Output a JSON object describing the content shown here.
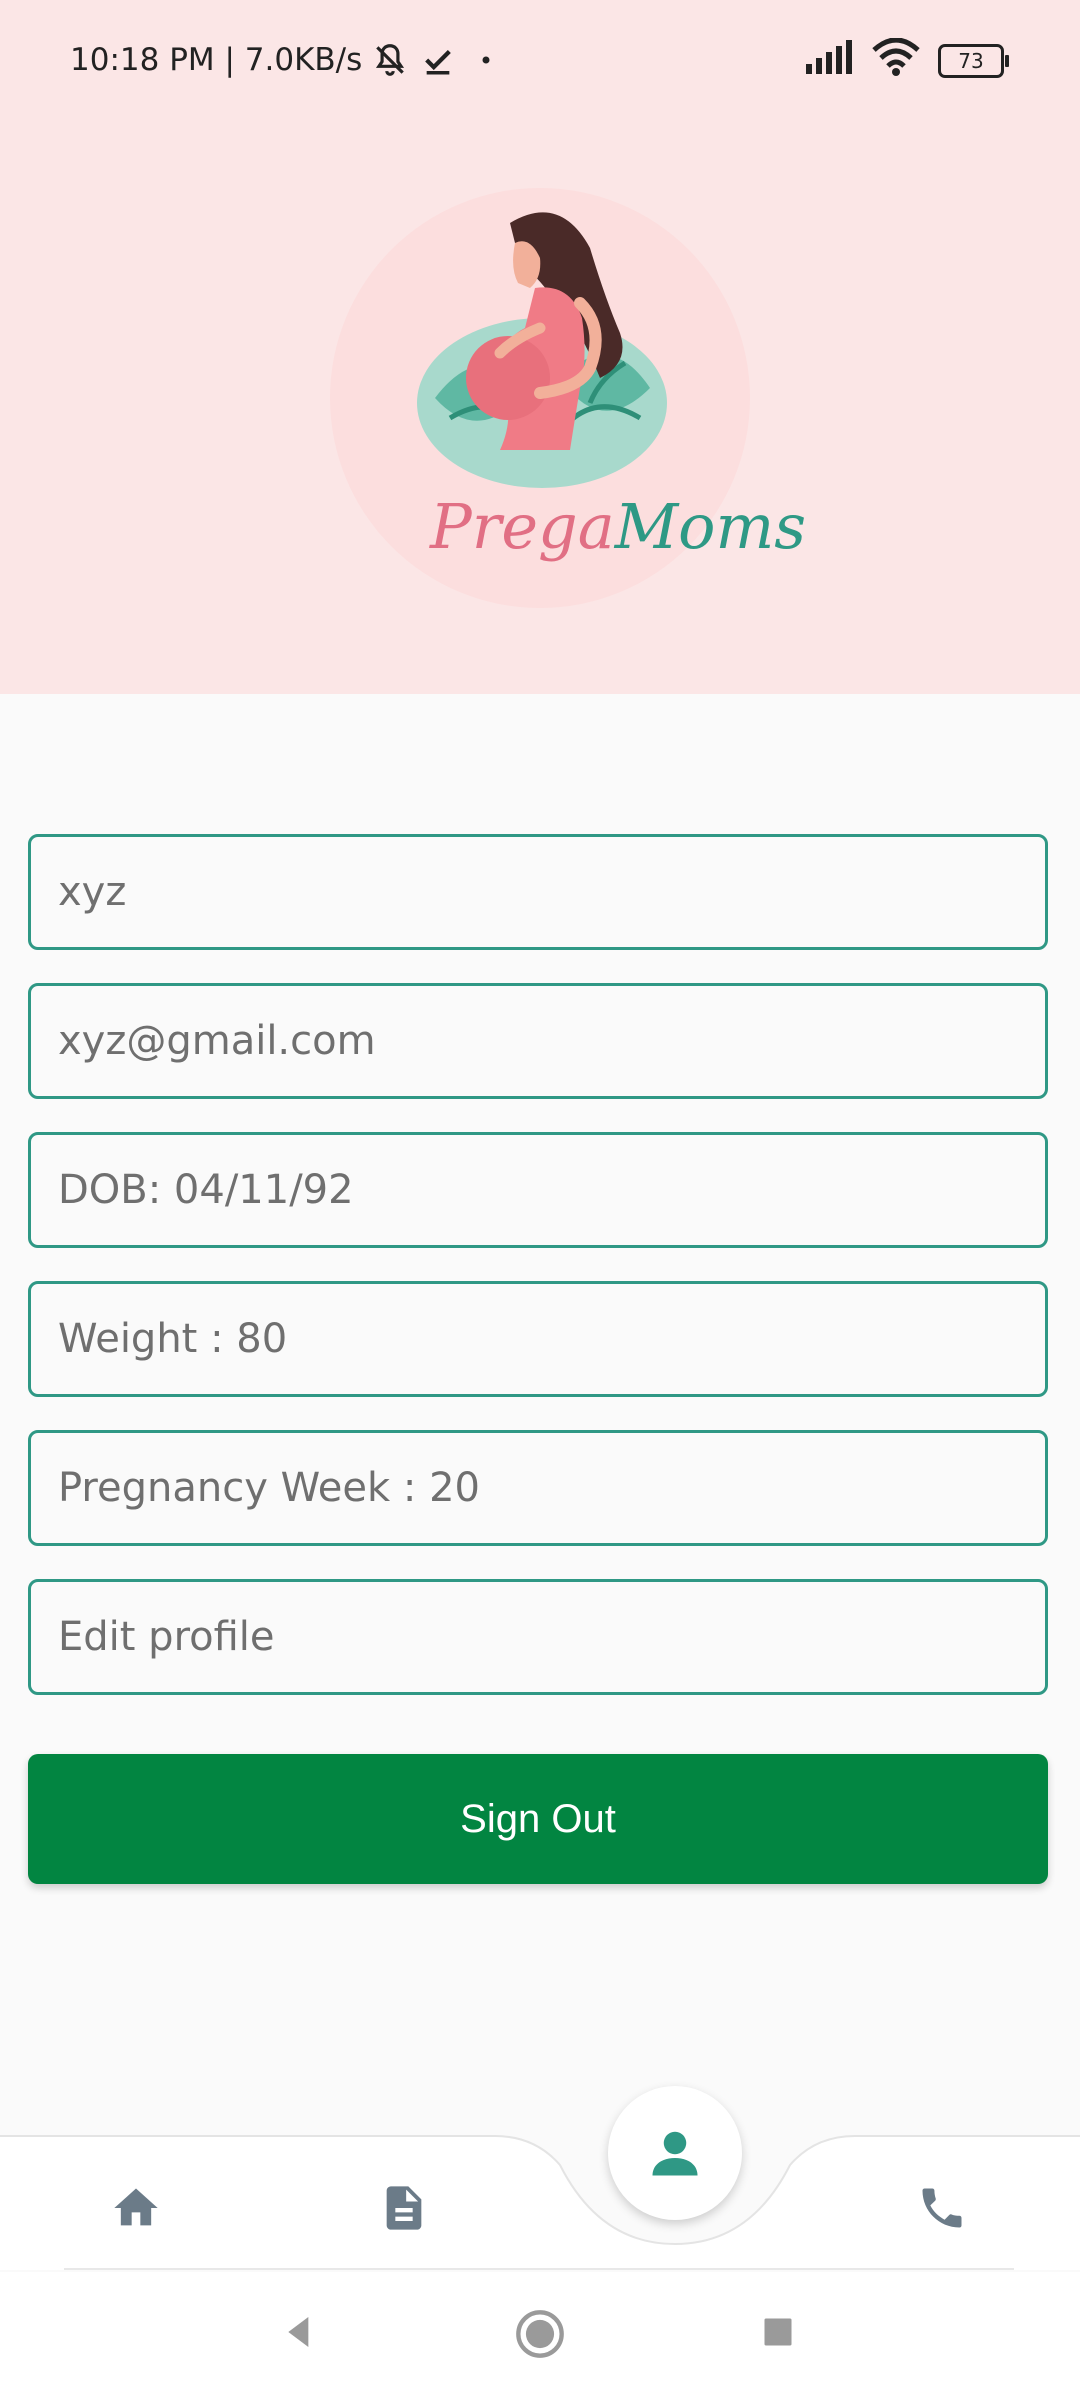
{
  "status_bar": {
    "time_speed": "10:18 PM | 7.0KB/s",
    "battery": "73",
    "icons": [
      "mute-bell-icon",
      "check-icon",
      "dot-icon",
      "signal-icon",
      "wifi-icon",
      "battery-icon"
    ]
  },
  "logo": {
    "brand_part1": "Prega",
    "brand_part2": "Moms",
    "colors": {
      "pink": "#e16f84",
      "teal": "#2e9985"
    }
  },
  "profile": {
    "name_value": "xyz",
    "email_value": "xyz@gmail.com",
    "dob_value": "DOB: 04/11/92",
    "weight_value": "Weight : 80",
    "pregnancy_week_value": "Pregnancy Week : 20",
    "edit_profile_label": "Edit profile"
  },
  "actions": {
    "signout_label": "Sign Out"
  },
  "bottom_nav": {
    "items": [
      "home-icon",
      "document-icon",
      "profile-icon",
      "phone-icon"
    ],
    "active": "profile-icon"
  },
  "system_nav": {
    "buttons": [
      "back-icon",
      "home-circle-icon",
      "recents-icon"
    ]
  },
  "colors": {
    "header_bg": "#fbe6e6",
    "accent_teal": "#2f9885",
    "button_green": "#028541",
    "icon_gray": "#6b7b88"
  }
}
